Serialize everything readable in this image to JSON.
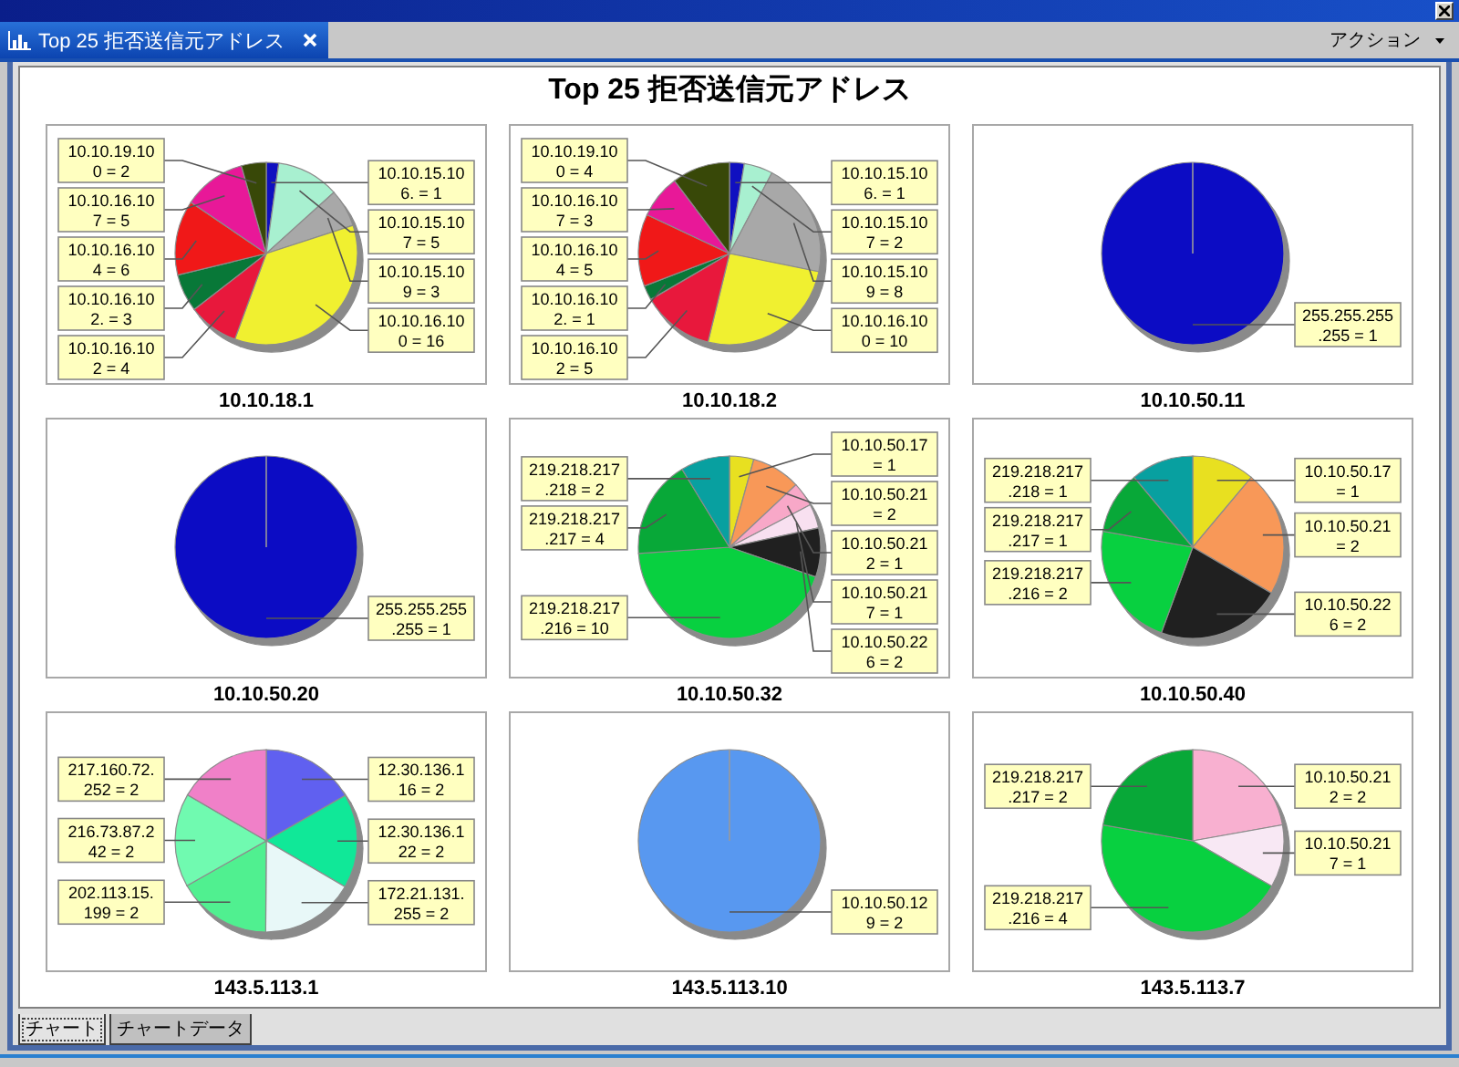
{
  "tabs": [
    {
      "label": "Top 25 拒否送信元アドレス",
      "selected": true
    }
  ],
  "action_menu": {
    "label": "アクション"
  },
  "report": {
    "title": "Top 25 拒否送信元アドレス",
    "charts": [
      {
        "chart_data": {
          "type": "pie",
          "title": "10.10.18.1",
          "values": [
            2.2,
            11.1,
            6.7,
            35.6,
            8.9,
            6.7,
            13.3,
            11.1,
            4.4
          ],
          "colors": [
            "#1010c0",
            "#a8f0d0",
            "#a8a8a8",
            "#f0f030",
            "#e8183c",
            "#087838",
            "#f01818",
            "#e81898",
            "#384808"
          ],
          "value_labels": [
            [
              "10.10.15.10",
              "6. = 1"
            ],
            [
              "10.10.15.10",
              "7 = 5"
            ],
            [
              "10.10.15.10",
              "9 = 3"
            ],
            [
              "10.10.16.10",
              "0 = 16"
            ],
            [
              "10.10.16.10",
              "2 = 4"
            ],
            [
              "10.10.16.10",
              "2. = 3"
            ],
            [
              "10.10.16.10",
              "4 = 6"
            ],
            [
              "10.10.16.10",
              "7 = 5"
            ],
            [
              "10.10.19.10",
              "0 = 2"
            ]
          ]
        }
      },
      {
        "chart_data": {
          "type": "pie",
          "title": "10.10.18.2",
          "values": [
            2.6,
            5.1,
            20.5,
            25.6,
            12.8,
            2.6,
            12.8,
            7.7,
            10.3
          ],
          "colors": [
            "#1010c0",
            "#a8f0d0",
            "#a8a8a8",
            "#f0f030",
            "#e8183c",
            "#087838",
            "#f01818",
            "#e81898",
            "#384808"
          ],
          "value_labels": [
            [
              "10.10.15.10",
              "6. = 1"
            ],
            [
              "10.10.15.10",
              "7 = 2"
            ],
            [
              "10.10.15.10",
              "9 = 8"
            ],
            [
              "10.10.16.10",
              "0 = 10"
            ],
            [
              "10.10.16.10",
              "2 = 5"
            ],
            [
              "10.10.16.10",
              "2. = 1"
            ],
            [
              "10.10.16.10",
              "4 = 5"
            ],
            [
              "10.10.16.10",
              "7 = 3"
            ],
            [
              "10.10.19.10",
              "0 = 4"
            ]
          ]
        }
      },
      {
        "chart_data": {
          "type": "pie",
          "title": "10.10.50.11",
          "values": [
            100
          ],
          "colors": [
            "#0c0cc4"
          ],
          "value_labels": [
            [
              "255.255.255",
              ".255 = 1"
            ]
          ]
        }
      },
      {
        "chart_data": {
          "type": "pie",
          "title": "10.10.50.20",
          "values": [
            100
          ],
          "colors": [
            "#0c0cc4"
          ],
          "value_labels": [
            [
              "255.255.255",
              ".255 = 1"
            ]
          ]
        }
      },
      {
        "chart_data": {
          "type": "pie",
          "title": "10.10.50.32",
          "values": [
            4.3,
            8.7,
            4.3,
            4.3,
            8.7,
            43.6,
            17.4,
            8.7
          ],
          "colors": [
            "#e8e020",
            "#f89858",
            "#f8a8c8",
            "#f8e0f0",
            "#202020",
            "#08d040",
            "#08a838",
            "#08a0a0"
          ],
          "value_labels": [
            [
              "10.10.50.17",
              "= 1"
            ],
            [
              "10.10.50.21",
              "= 2"
            ],
            [
              "10.10.50.21",
              "2 = 1"
            ],
            [
              "10.10.50.21",
              "7 = 1"
            ],
            [
              "10.10.50.22",
              "6 = 2"
            ],
            [
              "219.218.217",
              ".216 = 10"
            ],
            [
              "219.218.217",
              ".217 = 4"
            ],
            [
              "219.218.217",
              ".218 = 2"
            ]
          ]
        }
      },
      {
        "chart_data": {
          "type": "pie",
          "title": "10.10.50.40",
          "values": [
            11.1,
            22.3,
            22.2,
            22.2,
            11.1,
            11.1
          ],
          "colors": [
            "#e8e020",
            "#f89858",
            "#202020",
            "#08d040",
            "#08a838",
            "#08a0a0"
          ],
          "value_labels": [
            [
              "10.10.50.17",
              "= 1"
            ],
            [
              "10.10.50.21",
              "= 2"
            ],
            [
              "10.10.50.22",
              "6 = 2"
            ],
            [
              "219.218.217",
              ".216 = 2"
            ],
            [
              "219.218.217",
              ".217 = 1"
            ],
            [
              "219.218.217",
              ".218 = 1"
            ]
          ]
        }
      },
      {
        "chart_data": {
          "type": "pie",
          "title": "143.5.113.1",
          "values": [
            16.7,
            16.7,
            16.7,
            16.7,
            16.6,
            16.6
          ],
          "colors": [
            "#6060f0",
            "#10e898",
            "#e8f8f8",
            "#50f090",
            "#70fab0",
            "#f080c8"
          ],
          "value_labels": [
            [
              "12.30.136.1",
              "16 = 2"
            ],
            [
              "12.30.136.1",
              "22 = 2"
            ],
            [
              "172.21.131.",
              "255 = 2"
            ],
            [
              "202.113.15.",
              "199 = 2"
            ],
            [
              "216.73.87.2",
              "42 = 2"
            ],
            [
              "217.160.72.",
              "252 = 2"
            ]
          ]
        }
      },
      {
        "chart_data": {
          "type": "pie",
          "title": "143.5.113.10",
          "values": [
            100
          ],
          "colors": [
            "#5898f0"
          ],
          "value_labels": [
            [
              "10.10.50.12",
              "9 = 2"
            ]
          ]
        }
      },
      {
        "chart_data": {
          "type": "pie",
          "title": "143.5.113.7",
          "values": [
            22.2,
            11.1,
            44.5,
            22.2
          ],
          "colors": [
            "#f8b0d0",
            "#f8e8f4",
            "#08d040",
            "#08a838"
          ],
          "value_labels": [
            [
              "10.10.50.21",
              "2 = 2"
            ],
            [
              "10.10.50.21",
              "7 = 1"
            ],
            [
              "219.218.217",
              ".216 = 4"
            ],
            [
              "219.218.217",
              ".217 = 2"
            ]
          ]
        }
      }
    ]
  },
  "view_tabs": [
    {
      "label": "チャート",
      "selected": true
    },
    {
      "label": "チャートデータ",
      "selected": false
    }
  ]
}
